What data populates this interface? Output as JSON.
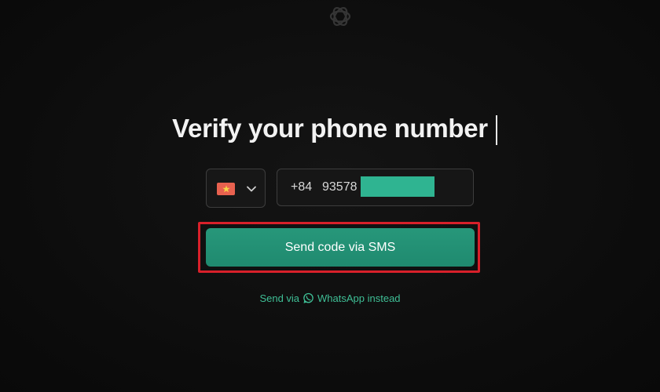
{
  "page": {
    "title": "Verify your phone number"
  },
  "logo": {
    "icon": "openai-logo-icon"
  },
  "phone": {
    "country_flag": "vietnam-flag-icon",
    "dropdown_icon": "chevron-down-icon",
    "prefix": "+84",
    "number": "93578"
  },
  "actions": {
    "send_sms_label": "Send code via SMS",
    "alt_prefix": "Send via",
    "alt_icon": "whatsapp-icon",
    "alt_suffix": "WhatsApp instead"
  },
  "colors": {
    "background": "#0e0e0e",
    "button": "#1f8a6f",
    "link": "#3fbf96",
    "highlight": "#d8202a",
    "redaction": "#2fb491"
  }
}
